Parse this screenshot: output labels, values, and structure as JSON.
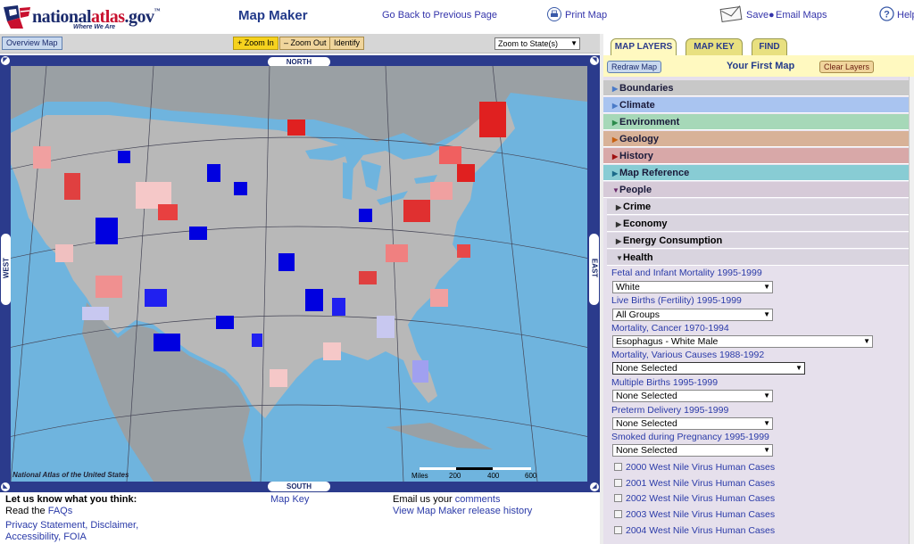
{
  "header": {
    "site_name_part1": "national",
    "site_name_part2": "atlas",
    "site_name_part3": ".gov",
    "tm": "™",
    "tagline": "Where We Are",
    "app_title": "Map Maker",
    "go_back": "Go Back to Previous Page",
    "print": "Print Map",
    "save": "Save",
    "email": "Email Maps",
    "help": "Help"
  },
  "toolbar": {
    "overview": "Overview Map",
    "zoom_in": "+ Zoom In",
    "zoom_out": "– Zoom Out",
    "identify": "Identify",
    "zoom_to": "Zoom to State(s)"
  },
  "map": {
    "north": "NORTH",
    "south": "SOUTH",
    "east": "EAST",
    "west": "WEST",
    "credit": "National Atlas of the United States",
    "scale_label": "Miles",
    "scale_ticks": [
      "200",
      "400",
      "600"
    ]
  },
  "footer": {
    "feedback": "Let us know what you think:",
    "read_the": "Read the ",
    "faqs": "FAQs",
    "privacy": "Privacy Statement, Disclaimer,",
    "accessibility": "Accessibility, FOIA",
    "map_key": "Map Key",
    "email_us": "Email us your ",
    "comments": "comments",
    "release_history": "View Map Maker release history"
  },
  "panel": {
    "tabs": [
      "MAP LAYERS",
      "MAP KEY",
      "FIND"
    ],
    "redraw": "Redraw Map",
    "first_map": "Your First Map",
    "clear": "Clear Layers",
    "categories": [
      {
        "label": "Boundaries",
        "color": "#c8c8c8"
      },
      {
        "label": "Climate",
        "color": "#a9c4f0"
      },
      {
        "label": "Environment",
        "color": "#a6d8b8"
      },
      {
        "label": "Geology",
        "color": "#d8b298"
      },
      {
        "label": "History",
        "color": "#d8a8a8"
      },
      {
        "label": "Map Reference",
        "color": "#88ccd4"
      },
      {
        "label": "People",
        "color": "#d6cad8"
      }
    ],
    "subcategories": [
      "Crime",
      "Economy",
      "Energy Consumption",
      "Health"
    ],
    "health_options": [
      {
        "label": "Fetal and Infant Mortality 1995-1999",
        "value": "White"
      },
      {
        "label": "Live Births (Fertility) 1995-1999",
        "value": "All Groups"
      },
      {
        "label": "Mortality, Cancer 1970-1994",
        "value": "Esophagus - White Male"
      },
      {
        "label": "Mortality, Various Causes 1988-1992",
        "value": "None Selected"
      },
      {
        "label": "Multiple Births 1995-1999",
        "value": "None Selected"
      },
      {
        "label": "Preterm Delivery 1995-1999",
        "value": "None Selected"
      },
      {
        "label": "Smoked during Pregnancy 1995-1999",
        "value": "None Selected"
      }
    ],
    "checkboxes": [
      "2000 West Nile Virus Human Cases",
      "2001 West Nile Virus Human Cases",
      "2002 West Nile Virus Human Cases",
      "2003 West Nile Virus Human Cases",
      "2004 West Nile Virus Human Cases"
    ]
  }
}
